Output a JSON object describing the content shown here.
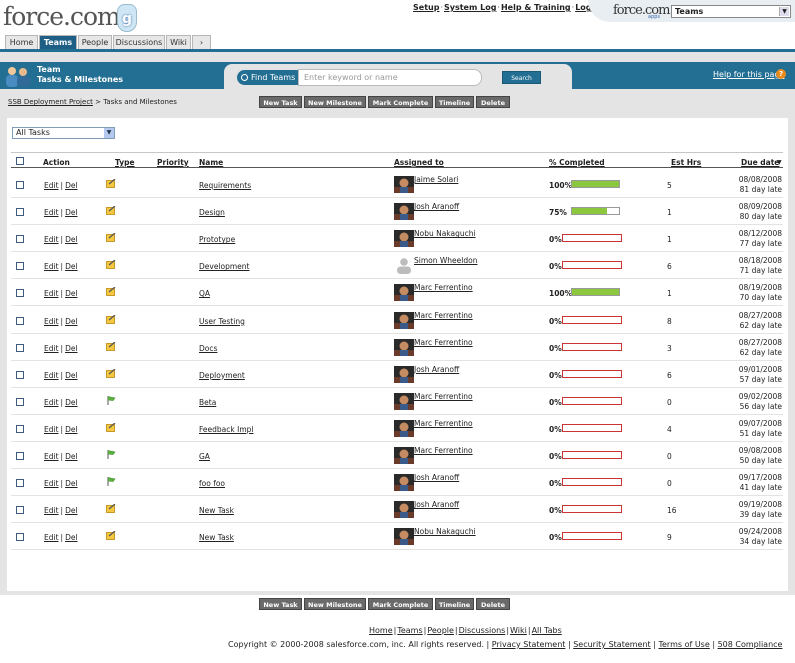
{
  "header": {
    "logo": "force.com",
    "badge": "g",
    "links": [
      "Setup",
      "System Log",
      "Help & Training",
      "Logout"
    ],
    "app_logo": "force.com",
    "app_logo_sub": "apps",
    "app_selected": "Teams"
  },
  "tabs": [
    "Home",
    "Teams",
    "People",
    "Discussions",
    "Wiki",
    "›"
  ],
  "active_tab": "Teams",
  "page": {
    "title_line1": "Team",
    "title_line2": "Tasks & Milestones",
    "find_button": "Find Teams",
    "search_placeholder": "Enter keyword or name",
    "search_button": "Search",
    "help_link": "Help for this page",
    "help_icon": "?"
  },
  "breadcrumb": {
    "link": "SSB Deployment Project",
    "sep": " > ",
    "current": "Tasks and Milestones"
  },
  "buttons": [
    "New Task",
    "New Milestone",
    "Mark Complete",
    "Timeline",
    "Delete"
  ],
  "filter": {
    "selected": "All Tasks"
  },
  "columns": {
    "action": "Action",
    "type": "Type",
    "priority": "Priority",
    "name": "Name",
    "assigned": "Assigned to",
    "pct": "% Completed",
    "est": "Est Hrs",
    "due": "Due date",
    "sort_arrow": "▼"
  },
  "action_links": {
    "edit": "Edit",
    "sep": "|",
    "del": "Del"
  },
  "colors": {
    "accent": "#236f93",
    "progress_fill": "#8dc63f",
    "progress_empty_border": "#cc3333"
  },
  "rows": [
    {
      "type": "task-icon",
      "name": "Requirements",
      "assigned": "Jaime Solari",
      "avatar": "photo",
      "pct": "100%",
      "progress": 1.0,
      "est": "5",
      "due": "08/08/2008",
      "late": "81 day late"
    },
    {
      "type": "task-icon",
      "name": "Design",
      "assigned": "Josh Aranoff",
      "avatar": "photo",
      "pct": "75%",
      "progress": 0.75,
      "est": "1",
      "due": "08/09/2008",
      "late": "80 day late"
    },
    {
      "type": "task-icon",
      "name": "Prototype",
      "assigned": "Nobu Nakaguchi",
      "avatar": "photo",
      "pct": "0%",
      "progress": 0,
      "est": "1",
      "due": "08/12/2008",
      "late": "77 day late"
    },
    {
      "type": "task-icon",
      "name": "Development",
      "assigned": "Simon Wheeldon",
      "avatar": "default",
      "pct": "0%",
      "progress": 0,
      "est": "6",
      "due": "08/18/2008",
      "late": "71 day late"
    },
    {
      "type": "task-icon",
      "name": "QA",
      "assigned": "Marc Ferrentino",
      "avatar": "photo",
      "pct": "100%",
      "progress": 1.0,
      "est": "1",
      "due": "08/19/2008",
      "late": "70 day late"
    },
    {
      "type": "task-icon",
      "name": "User Testing",
      "assigned": "Marc Ferrentino",
      "avatar": "photo",
      "pct": "0%",
      "progress": 0,
      "est": "8",
      "due": "08/27/2008",
      "late": "62 day late"
    },
    {
      "type": "task-icon",
      "name": "Docs",
      "assigned": "Marc Ferrentino",
      "avatar": "photo",
      "pct": "0%",
      "progress": 0,
      "est": "3",
      "due": "08/27/2008",
      "late": "62 day late"
    },
    {
      "type": "task-icon",
      "name": "Deployment",
      "assigned": "Josh Aranoff",
      "avatar": "photo",
      "pct": "0%",
      "progress": 0,
      "est": "6",
      "due": "09/01/2008",
      "late": "57 day late"
    },
    {
      "type": "milestone-icon",
      "name": "Beta",
      "assigned": "Marc Ferrentino",
      "avatar": "photo",
      "pct": "0%",
      "progress": 0,
      "est": "0",
      "due": "09/02/2008",
      "late": "56 day late"
    },
    {
      "type": "task-icon",
      "name": "Feedback Impl",
      "assigned": "Marc Ferrentino",
      "avatar": "photo",
      "pct": "0%",
      "progress": 0,
      "est": "4",
      "due": "09/07/2008",
      "late": "51 day late"
    },
    {
      "type": "milestone-icon",
      "name": "GA",
      "assigned": "Marc Ferrentino",
      "avatar": "photo",
      "pct": "0%",
      "progress": 0,
      "est": "0",
      "due": "09/08/2008",
      "late": "50 day late"
    },
    {
      "type": "milestone-icon",
      "name": "foo foo",
      "assigned": "Josh Aranoff",
      "avatar": "photo",
      "pct": "0%",
      "progress": 0,
      "est": "0",
      "due": "09/17/2008",
      "late": "41 day late"
    },
    {
      "type": "task-icon",
      "name": "New Task",
      "assigned": "Josh Aranoff",
      "avatar": "photo",
      "pct": "0%",
      "progress": 0,
      "est": "16",
      "due": "09/19/2008",
      "late": "39 day late"
    },
    {
      "type": "task-icon",
      "name": "New Task",
      "assigned": "Nobu Nakaguchi",
      "avatar": "photo",
      "pct": "0%",
      "progress": 0,
      "est": "9",
      "due": "09/24/2008",
      "late": "34 day late"
    }
  ],
  "footer": {
    "links": [
      "Home",
      "Teams",
      "People",
      "Discussions",
      "Wiki",
      "All Tabs"
    ],
    "copyright": "Copyright © 2000-2008 salesforce.com, inc. All rights reserved.",
    "legal": [
      "Privacy Statement",
      "Security Statement",
      "Terms of Use",
      "508 Compliance"
    ]
  }
}
